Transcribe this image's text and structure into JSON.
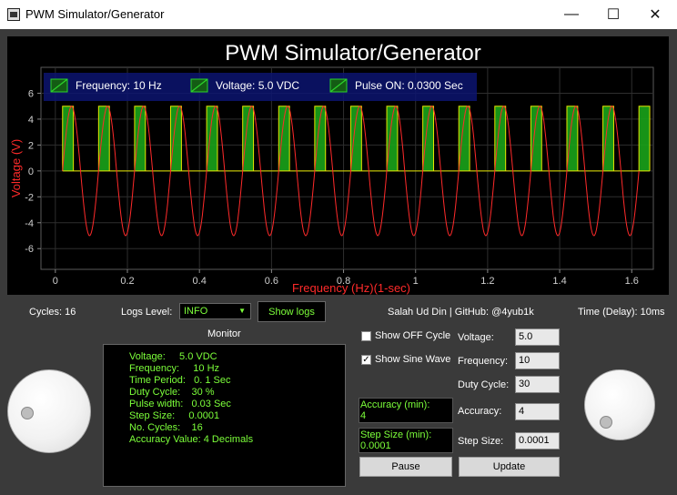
{
  "window": {
    "title": "PWM Simulator/Generator",
    "minimize": "—",
    "maximize": "☐",
    "close": "✕"
  },
  "plot": {
    "title": "PWM Simulator/Generator",
    "legend": [
      {
        "label": "Frequency: 10 Hz",
        "icon": "line-icon"
      },
      {
        "label": "Voltage: 5.0 VDC",
        "icon": "line-icon"
      },
      {
        "label": "Pulse ON: 0.0300 Sec",
        "icon": "line-icon"
      }
    ],
    "colors": {
      "sine": "#ff2a2a",
      "pulse_fill": "#19a319",
      "pulse_edge": "#e6e600",
      "axis_text": "#ff2a2a",
      "tick_text": "#cfcfcf"
    }
  },
  "chart_data": {
    "type": "line",
    "title": "PWM Simulator/Generator",
    "xlabel": "Frequency (Hz)(1-sec)",
    "ylabel": "Voltage (V)",
    "xlim": [
      -0.04,
      1.66
    ],
    "ylim": [
      -7.6,
      8.0
    ],
    "xticks": [
      "0",
      "0.2",
      "0.4",
      "0.6",
      "0.8",
      "1",
      "1.2",
      "1.4",
      "1.6"
    ],
    "yticks": [
      "-6",
      "-4",
      "-2",
      "0",
      "2",
      "4",
      "6"
    ],
    "grid": true,
    "series": [
      {
        "name": "Frequency: 10 Hz",
        "kind": "sine",
        "amplitude": 5.0,
        "frequency": 10,
        "x_start": 0.02,
        "x_end": 1.62
      },
      {
        "name": "Pulse ON: 0.0300 Sec",
        "kind": "pulse",
        "amplitude": 5.0,
        "period": 0.1,
        "width": 0.03,
        "starts": [
          0.02,
          0.12,
          0.22,
          0.32,
          0.42,
          0.52,
          0.62,
          0.72,
          0.82,
          0.92,
          1.02,
          1.12,
          1.22,
          1.32,
          1.42,
          1.52,
          1.62
        ]
      }
    ]
  },
  "controls": {
    "cycles_label": "Cycles: 16",
    "logs_level_label": "Logs Level:",
    "logs_level_value": "INFO",
    "show_logs": "Show logs",
    "author": "Salah Ud Din | GitHub: @4yub1k",
    "time_delay": "Time (Delay): 10ms",
    "monitor_label": "Monitor",
    "show_off_cycle": "Show OFF Cycle",
    "show_sine_wave": "Show Sine Wave",
    "show_off_checked": false,
    "show_sine_checked": true,
    "accuracy_min_label": "Accuracy (min):",
    "accuracy_min_value": "4",
    "step_size_min_label": "Step Size (min):",
    "step_size_min_value": "0.0001",
    "voltage_label": "Voltage:",
    "voltage_value": "5.0",
    "frequency_label": "Frequency:",
    "frequency_value": "10",
    "duty_cycle_label": "Duty Cycle:",
    "duty_cycle_value": "30",
    "accuracy_label": "Accuracy:",
    "accuracy_value": "4",
    "step_size_label": "Step Size:",
    "step_size_value": "0.0001",
    "pause": "Pause",
    "update": "Update"
  },
  "monitor": [
    "Voltage:     5.0 VDC",
    "Frequency:     10 Hz",
    "Time Period:   0. 1 Sec",
    "Duty Cycle:    30 %",
    "Pulse width:   0.03 Sec",
    "Step Size:     0.0001",
    "No. Cycles:    16",
    "Accuracy Value: 4 Decimals"
  ]
}
